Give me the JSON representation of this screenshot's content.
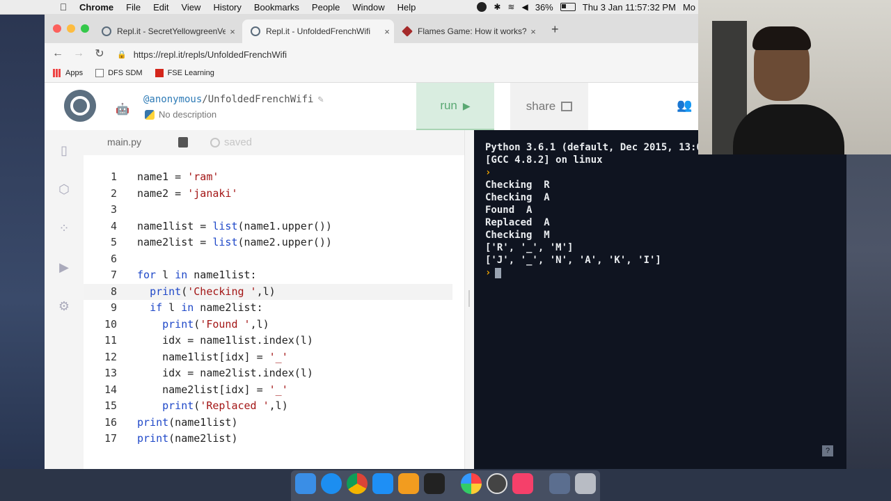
{
  "menubar": {
    "apple": "",
    "app": "Chrome",
    "items": [
      "File",
      "Edit",
      "View",
      "History",
      "Bookmarks",
      "People",
      "Window",
      "Help"
    ],
    "battery": "36%",
    "clock": "Thu 3 Jan  11:57:32 PM",
    "user": "Mo"
  },
  "tabs": [
    {
      "label": "Repl.it - SecretYellowgreenVer",
      "close": "×"
    },
    {
      "label": "Repl.it - UnfoldedFrenchWifi",
      "close": "×"
    },
    {
      "label": "Flames Game: How it works?",
      "close": "×"
    }
  ],
  "new_tab": "+",
  "toolbar": {
    "back": "←",
    "forward": "→",
    "reload": "↻",
    "url": "https://repl.it/repls/UnfoldedFrenchWifi"
  },
  "bookmarks": [
    {
      "label": "Apps"
    },
    {
      "label": "DFS SDM"
    },
    {
      "label": "FSE Learning"
    }
  ],
  "repl": {
    "user": "@anonymous",
    "slash": "/",
    "name": "UnfoldedFrenchWifi",
    "description": "No description",
    "run_label": "run",
    "share_label": "share"
  },
  "editor": {
    "file_tab": "main.py",
    "saved_label": "saved",
    "lines": [
      {
        "n": "1",
        "text": "name1 = 'ram'"
      },
      {
        "n": "2",
        "text": "name2 = 'janaki'"
      },
      {
        "n": "3",
        "text": ""
      },
      {
        "n": "4",
        "text": "name1list = list(name1.upper())"
      },
      {
        "n": "5",
        "text": "name2list = list(name2.upper())"
      },
      {
        "n": "6",
        "text": ""
      },
      {
        "n": "7",
        "text": "for l in name1list:"
      },
      {
        "n": "8",
        "text": "  print('Checking ',l)"
      },
      {
        "n": "9",
        "text": "  if l in name2list:"
      },
      {
        "n": "10",
        "text": "    print('Found ',l)"
      },
      {
        "n": "11",
        "text": "    idx = name1list.index(l)"
      },
      {
        "n": "12",
        "text": "    name1list[idx] = '_'"
      },
      {
        "n": "13",
        "text": "    idx = name2list.index(l)"
      },
      {
        "n": "14",
        "text": "    name2list[idx] = '_'"
      },
      {
        "n": "15",
        "text": "    print('Replaced ',l)"
      },
      {
        "n": "16",
        "text": "print(name1list)"
      },
      {
        "n": "17",
        "text": "print(name2list)"
      }
    ]
  },
  "console": {
    "lines": [
      "Python 3.6.1 (default, Dec 2015, 13:05:11)",
      "[GCC 4.8.2] on linux",
      "",
      "Checking  R",
      "Checking  A",
      "Found  A",
      "Replaced  A",
      "Checking  M",
      "['R', '_', 'M']",
      "['J', '_', 'N', 'A', 'K', 'I']",
      ""
    ],
    "prompt": "›",
    "help": "?"
  },
  "colors": {
    "accent": "#5aa873",
    "console_bg": "#0f1420",
    "keyword": "#1f48c8",
    "string": "#a31515"
  }
}
